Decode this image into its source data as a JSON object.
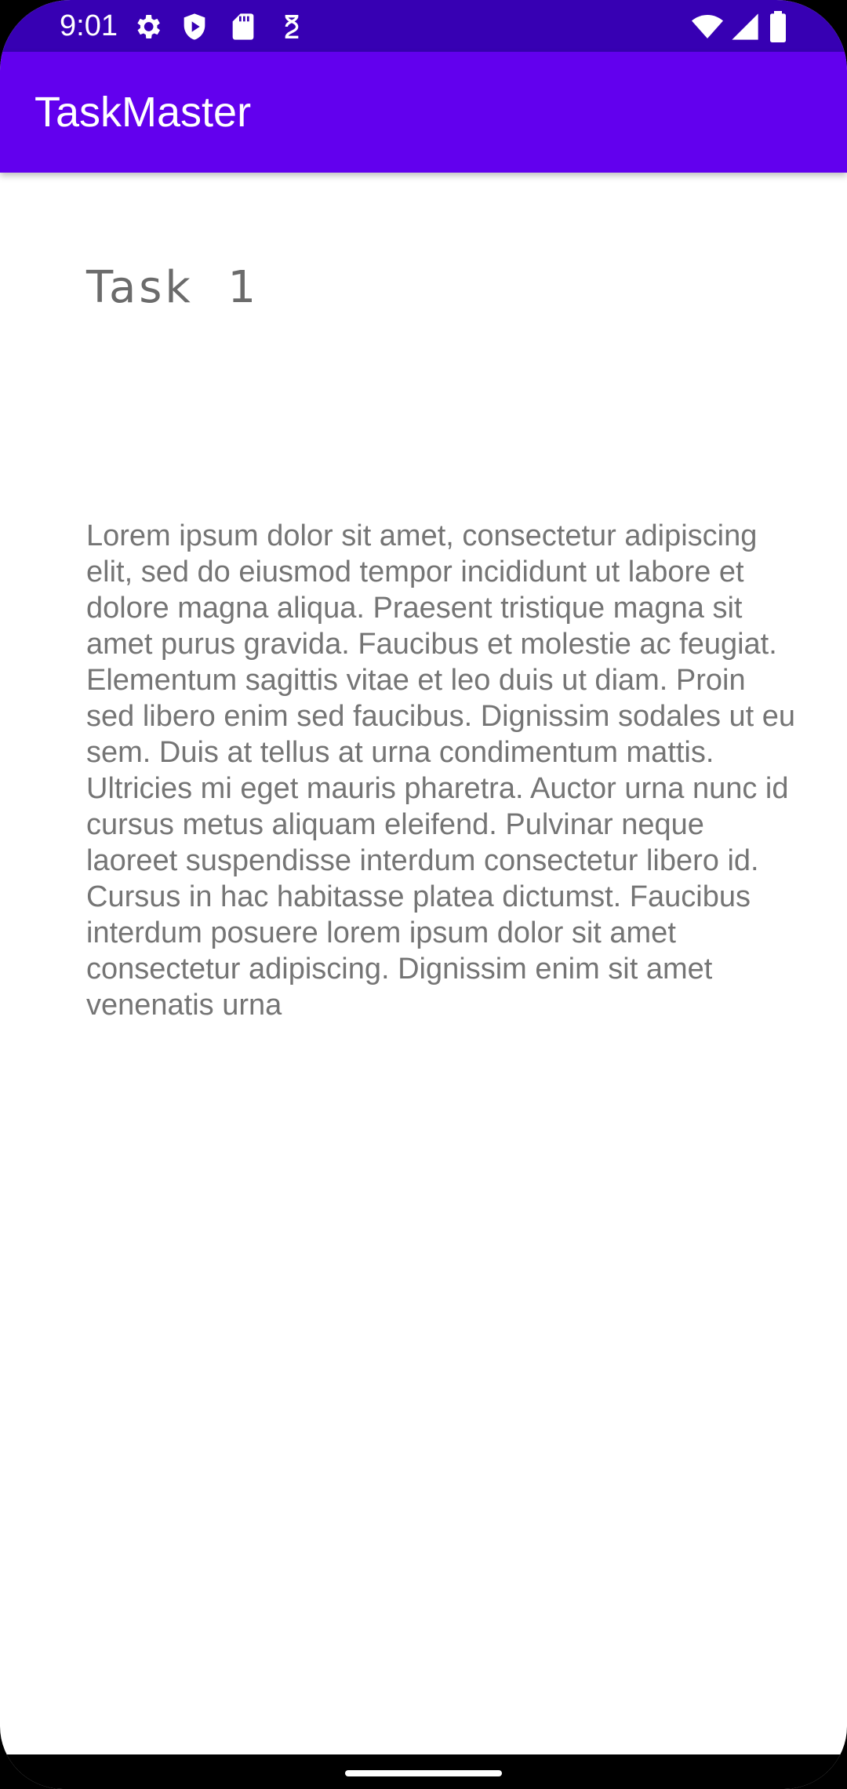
{
  "status_bar": {
    "time": "9:01",
    "left_icons": [
      "settings-gear-icon",
      "shield-play-icon",
      "sd-card-icon",
      "digital-wellbeing-icon"
    ],
    "right_icons": [
      "wifi-icon",
      "signal-icon",
      "battery-icon"
    ]
  },
  "app_bar": {
    "title": "TaskMaster",
    "color": "#6200ee",
    "status_color": "#3700b3"
  },
  "task": {
    "title": "Task  1",
    "body": "Lorem ipsum dolor sit amet, consectetur adipiscing elit, sed do eiusmod tempor incididunt ut labore et dolore magna aliqua. Praesent tristique magna sit amet purus gravida. Faucibus et molestie ac feugiat. Elementum sagittis vitae et leo duis ut diam. Proin sed libero enim sed faucibus. Dignissim sodales ut eu sem. Duis at tellus at urna condimentum mattis. Ultricies mi eget mauris pharetra. Auctor urna nunc id cursus metus aliquam eleifend. Pulvinar neque laoreet suspendisse interdum consectetur libero id. Cursus in hac habitasse platea dictumst. Faucibus interdum posuere lorem ipsum dolor sit amet consectetur adipiscing. Dignissim enim sit amet venenatis urna"
  }
}
